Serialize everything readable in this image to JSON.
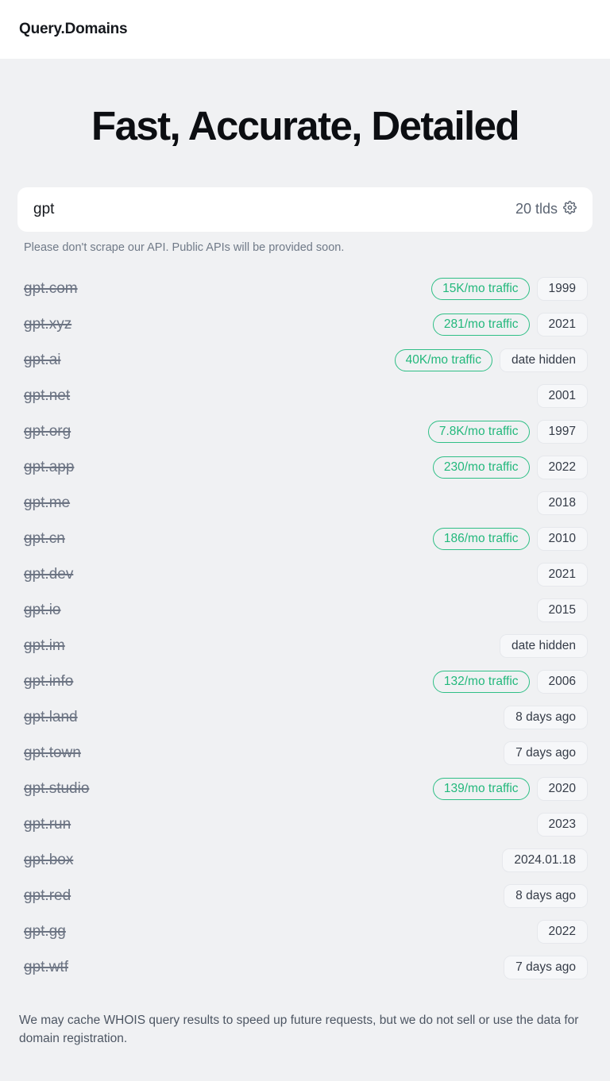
{
  "header": {
    "brand": "Query.Domains"
  },
  "hero": {
    "title": "Fast, Accurate, Detailed"
  },
  "search": {
    "value": "gpt",
    "placeholder": "gpt",
    "tld_count_label": "20 tlds",
    "settings_icon": "gear-icon"
  },
  "notes": {
    "api": "Please don't scrape our API. Public APIs will be provided soon.",
    "footer": "We may cache WHOIS query results to speed up future requests, but we do not sell or use the data for domain registration."
  },
  "colors": {
    "page_background": "#f0f1f3",
    "topbar_background": "#ffffff",
    "traffic_badge_accent": "#23b87c",
    "traffic_badge_border": "#2fbf86",
    "date_badge_background": "#f6f7f9",
    "date_badge_border": "#e6e8ec",
    "domain_text": "#6c7483",
    "title_text": "#0c0e12"
  },
  "results": [
    {
      "domain": "gpt.com",
      "taken": true,
      "traffic": "15K/mo traffic",
      "date": "1999"
    },
    {
      "domain": "gpt.xyz",
      "taken": true,
      "traffic": "281/mo traffic",
      "date": "2021"
    },
    {
      "domain": "gpt.ai",
      "taken": true,
      "traffic": "40K/mo traffic",
      "date": "date hidden"
    },
    {
      "domain": "gpt.net",
      "taken": true,
      "traffic": "",
      "date": "2001"
    },
    {
      "domain": "gpt.org",
      "taken": true,
      "traffic": "7.8K/mo traffic",
      "date": "1997"
    },
    {
      "domain": "gpt.app",
      "taken": true,
      "traffic": "230/mo traffic",
      "date": "2022"
    },
    {
      "domain": "gpt.me",
      "taken": true,
      "traffic": "",
      "date": "2018"
    },
    {
      "domain": "gpt.cn",
      "taken": true,
      "traffic": "186/mo traffic",
      "date": "2010"
    },
    {
      "domain": "gpt.dev",
      "taken": true,
      "traffic": "",
      "date": "2021"
    },
    {
      "domain": "gpt.io",
      "taken": true,
      "traffic": "",
      "date": "2015"
    },
    {
      "domain": "gpt.im",
      "taken": true,
      "traffic": "",
      "date": "date hidden"
    },
    {
      "domain": "gpt.info",
      "taken": true,
      "traffic": "132/mo traffic",
      "date": "2006"
    },
    {
      "domain": "gpt.land",
      "taken": true,
      "traffic": "",
      "date": "8 days ago"
    },
    {
      "domain": "gpt.town",
      "taken": true,
      "traffic": "",
      "date": "7 days ago"
    },
    {
      "domain": "gpt.studio",
      "taken": true,
      "traffic": "139/mo traffic",
      "date": "2020"
    },
    {
      "domain": "gpt.run",
      "taken": true,
      "traffic": "",
      "date": "2023"
    },
    {
      "domain": "gpt.box",
      "taken": true,
      "traffic": "",
      "date": "2024.01.18"
    },
    {
      "domain": "gpt.red",
      "taken": true,
      "traffic": "",
      "date": "8 days ago"
    },
    {
      "domain": "gpt.gg",
      "taken": true,
      "traffic": "",
      "date": "2022"
    },
    {
      "domain": "gpt.wtf",
      "taken": true,
      "traffic": "",
      "date": "7 days ago"
    }
  ]
}
